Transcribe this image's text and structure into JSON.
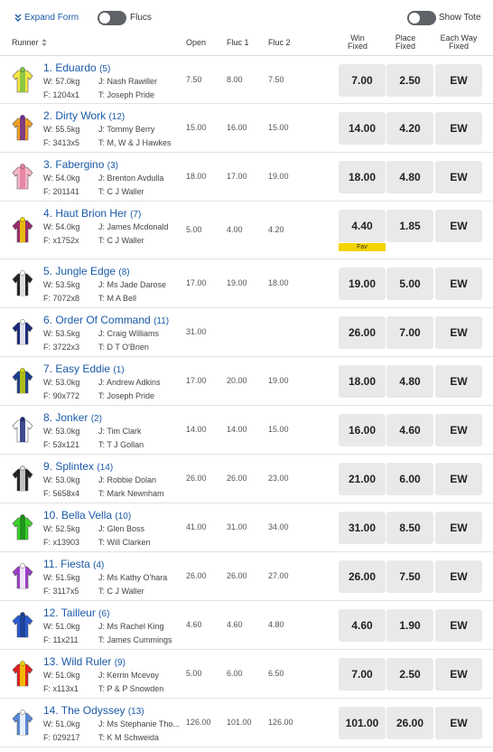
{
  "topbar": {
    "expand_form": "Expand Form",
    "flucs": "Flucs",
    "show_tote": "Show Tote"
  },
  "header": {
    "runner": "Runner",
    "open": "Open",
    "fluc1": "Fluc 1",
    "fluc2": "Fluc 2",
    "win_fixed_1": "Win",
    "win_fixed_2": "Fixed",
    "place_fixed_1": "Place",
    "place_fixed_2": "Fixed",
    "ew_1": "Each Way",
    "ew_2": "Fixed"
  },
  "runners": [
    {
      "name": "1. Eduardo",
      "barrier": "(5)",
      "weight": "W: 57.0kg",
      "jockey": "J: Nash Rawiller",
      "form": "F: 1204x1",
      "trainer": "T: Joseph Pride",
      "open": "7.50",
      "fluc1": "8.00",
      "fluc2": "7.50",
      "win": "7.00",
      "place": "2.50",
      "ew": "EW",
      "fav": "",
      "silk": [
        "#f5e642",
        "#7ac142"
      ]
    },
    {
      "name": "2. Dirty Work",
      "barrier": "(12)",
      "weight": "W: 55.5kg",
      "jockey": "J: Tommy Berry",
      "form": "F: 3413x5",
      "trainer": "T: M, W & J Hawkes",
      "open": "15.00",
      "fluc1": "16.00",
      "fluc2": "15.00",
      "win": "14.00",
      "place": "4.20",
      "ew": "EW",
      "fav": "",
      "silk": [
        "#f0a020",
        "#6a2c91"
      ]
    },
    {
      "name": "3. Fabergino",
      "barrier": "(3)",
      "weight": "W: 54.0kg",
      "jockey": "J: Brenton Avdulla",
      "form": "F: 201141",
      "trainer": "T: C J Waller",
      "open": "18.00",
      "fluc1": "17.00",
      "fluc2": "19.00",
      "win": "18.00",
      "place": "4.80",
      "ew": "EW",
      "fav": "",
      "silk": [
        "#f4b6c6",
        "#e37ea0"
      ]
    },
    {
      "name": "4. Haut Brion Her",
      "barrier": "(7)",
      "weight": "W: 54.0kg",
      "jockey": "J: James Mcdonald",
      "form": "F: x1752x",
      "trainer": "T: C J Waller",
      "open": "5.00",
      "fluc1": "4.00",
      "fluc2": "4.20",
      "win": "4.40",
      "place": "1.85",
      "ew": "EW",
      "fav": "Fav",
      "silk": [
        "#9b2a6b",
        "#f5d300"
      ]
    },
    {
      "name": "5. Jungle Edge",
      "barrier": "(8)",
      "weight": "W: 53.5kg",
      "jockey": "J: Ms Jade Darose",
      "form": "F: 7072x8",
      "trainer": "T: M A Bell",
      "open": "17.00",
      "fluc1": "19.00",
      "fluc2": "18.00",
      "win": "19.00",
      "place": "5.00",
      "ew": "EW",
      "fav": "",
      "silk": [
        "#222222",
        "#ffffff"
      ]
    },
    {
      "name": "6. Order Of Command",
      "barrier": "(11)",
      "weight": "W: 53.5kg",
      "jockey": "J: Craig Williams",
      "form": "F: 3722x3",
      "trainer": "T: D T O'Brien",
      "open": "31.00",
      "fluc1": "",
      "fluc2": "",
      "win": "26.00",
      "place": "7.00",
      "ew": "EW",
      "fav": "",
      "silk": [
        "#1b2a7a",
        "#ffffff"
      ]
    },
    {
      "name": "7. Easy Eddie",
      "barrier": "(1)",
      "weight": "W: 53.0kg",
      "jockey": "J: Andrew Adkins",
      "form": "F: 90x772",
      "trainer": "T: Joseph Pride",
      "open": "17.00",
      "fluc1": "20.00",
      "fluc2": "19.00",
      "win": "18.00",
      "place": "4.80",
      "ew": "EW",
      "fav": "",
      "silk": [
        "#1b3f8f",
        "#c8d400"
      ]
    },
    {
      "name": "8. Jonker",
      "barrier": "(2)",
      "weight": "W: 53.0kg",
      "jockey": "J: Tim Clark",
      "form": "F: 53x121",
      "trainer": "T: T J Gollan",
      "open": "14.00",
      "fluc1": "14.00",
      "fluc2": "15.00",
      "win": "16.00",
      "place": "4.60",
      "ew": "EW",
      "fav": "",
      "silk": [
        "#ffffff",
        "#1b2a7a"
      ]
    },
    {
      "name": "9. Splintex",
      "barrier": "(14)",
      "weight": "W: 53.0kg",
      "jockey": "J: Robbie Dolan",
      "form": "F: 5658x4",
      "trainer": "T: Mark Newnham",
      "open": "26.00",
      "fluc1": "26.00",
      "fluc2": "23.00",
      "win": "21.00",
      "place": "6.00",
      "ew": "EW",
      "fav": "",
      "silk": [
        "#222222",
        "#dddddd"
      ]
    },
    {
      "name": "10. Bella Vella",
      "barrier": "(10)",
      "weight": "W: 52.5kg",
      "jockey": "J: Glen Boss",
      "form": "F: x13903",
      "trainer": "T: Will Clarken",
      "open": "41.00",
      "fluc1": "31.00",
      "fluc2": "34.00",
      "win": "31.00",
      "place": "8.50",
      "ew": "EW",
      "fav": "",
      "silk": [
        "#3bd12a",
        "#1a8a1a"
      ]
    },
    {
      "name": "11. Fiesta",
      "barrier": "(4)",
      "weight": "W: 51.5kg",
      "jockey": "J: Ms Kathy O'hara",
      "form": "F: 3117x5",
      "trainer": "T: C J Waller",
      "open": "26.00",
      "fluc1": "26.00",
      "fluc2": "27.00",
      "win": "26.00",
      "place": "7.50",
      "ew": "EW",
      "fav": "",
      "silk": [
        "#9b3fc8",
        "#ffffff"
      ]
    },
    {
      "name": "12. Tailleur",
      "barrier": "(6)",
      "weight": "W: 51.0kg",
      "jockey": "J: Ms Rachel King",
      "form": "F: 11x211",
      "trainer": "T: James Cummings",
      "open": "4.60",
      "fluc1": "4.60",
      "fluc2": "4.80",
      "win": "4.60",
      "place": "1.90",
      "ew": "EW",
      "fav": "",
      "silk": [
        "#2a5ad1",
        "#1b3f8f"
      ]
    },
    {
      "name": "13. Wild Ruler",
      "barrier": "(9)",
      "weight": "W: 51.0kg",
      "jockey": "J: Kerrin Mcevoy",
      "form": "F: x113x1",
      "trainer": "T: P & P Snowden",
      "open": "5.00",
      "fluc1": "6.00",
      "fluc2": "6.50",
      "win": "7.00",
      "place": "2.50",
      "ew": "EW",
      "fav": "",
      "silk": [
        "#e02020",
        "#f5d300"
      ]
    },
    {
      "name": "14. The Odyssey",
      "barrier": "(13)",
      "weight": "W: 51.0kg",
      "jockey": "J: Ms Stephanie Tho...",
      "form": "F: 029217",
      "trainer": "T: K M Schweida",
      "open": "126.00",
      "fluc1": "101.00",
      "fluc2": "126.00",
      "win": "101.00",
      "place": "26.00",
      "ew": "EW",
      "fav": "",
      "silk": [
        "#5a8ad8",
        "#ffffff"
      ]
    }
  ]
}
